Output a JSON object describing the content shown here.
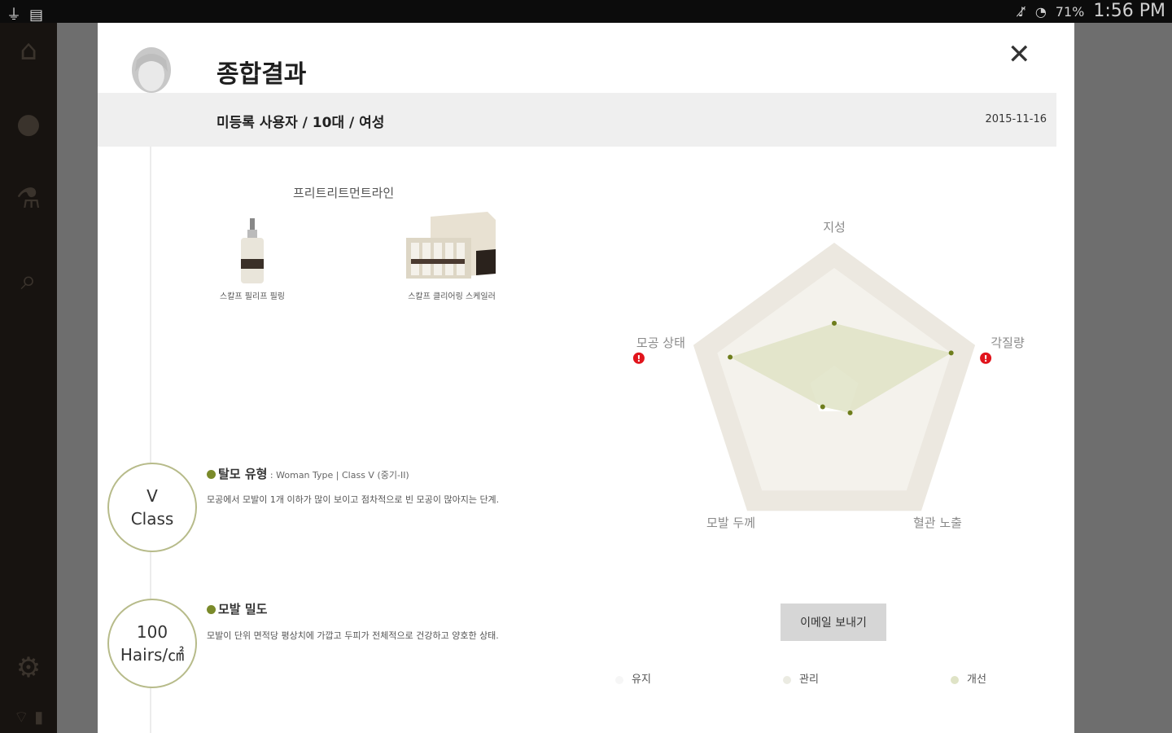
{
  "status_bar": {
    "left_icons": [
      "usb-icon",
      "keyboard-icon"
    ],
    "right_icons": [
      "mute-icon",
      "wifi-icon"
    ],
    "battery": "71%",
    "time": "1:56 PM"
  },
  "sidebar": {
    "items": [
      {
        "icon": "home-icon"
      },
      {
        "icon": "user-icon"
      },
      {
        "icon": "microscope-icon"
      },
      {
        "icon": "search-icon"
      },
      {
        "icon": "gear-icon"
      }
    ]
  },
  "modal": {
    "title": "종합결과",
    "user_info": "미등록 사용자 / 10대 / 여성",
    "date": "2015-11-16",
    "recommendation": {
      "line_title": "프리트리트먼트라인",
      "products": [
        {
          "name": "스칼프 필리프 필링"
        },
        {
          "name": "스칼프 클리어링 스케일러"
        }
      ]
    },
    "hair_loss_type": {
      "circle_line1": "V",
      "circle_line2": "Class",
      "title": "탈모 유형",
      "subtitle": " : Woman Type | Class V (중기-II)",
      "description": "모공에서 모발이 1개 이하가 많이 보이고 점차적으로 빈 모공이 많아지는 단계."
    },
    "hair_density": {
      "circle_line1": "100",
      "circle_line2": "Hairs/㎠",
      "title": "모발 밀도",
      "description": "모발이 단위 면적당 평상치에 가깝고 두피가 전체적으로 건강하고 양호한 상태."
    },
    "email_button": "이메일 보내기",
    "legend": [
      {
        "label": "유지",
        "color": "#f6f6f6"
      },
      {
        "label": "관리",
        "color": "#ebebe2"
      },
      {
        "label": "개선",
        "color": "#dfe3c6"
      }
    ]
  },
  "chart_data": {
    "type": "radar",
    "axes": [
      "지성",
      "각질량",
      "혈관 노출",
      "모발 두께",
      "모공 상태"
    ],
    "alert_axes": [
      "각질량",
      "모공 상태"
    ],
    "series": [
      {
        "values": [
          0.55,
          1.0,
          0.22,
          0.16,
          0.89
        ]
      }
    ],
    "bands": [
      "개선",
      "관리",
      "유지"
    ],
    "colors": {
      "series_fill": "#dfe3c6",
      "point": "#6e7d1c",
      "alert": "#e1141c"
    }
  }
}
